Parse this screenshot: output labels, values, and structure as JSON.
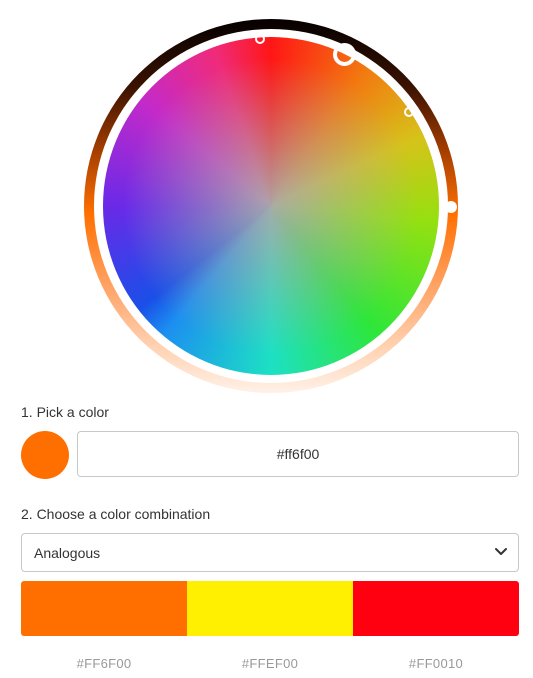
{
  "picker": {
    "selected_color": "#ff6f00",
    "step1_label": "1. Pick a color",
    "hex_value": "#ff6f00",
    "step2_label": "2. Choose a color combination",
    "combination": "Analogous"
  },
  "palette": {
    "colors": [
      {
        "label": "#FF6F00",
        "color": "#FF6F00"
      },
      {
        "label": "#FFEF00",
        "color": "#FFEF00"
      },
      {
        "label": "#FF0010",
        "color": "#FF0010"
      }
    ]
  },
  "icons": {
    "dropdown": "chevron-down-icon"
  }
}
